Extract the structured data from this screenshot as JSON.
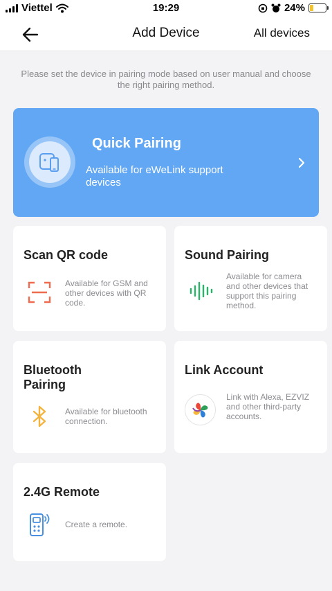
{
  "status_bar": {
    "carrier": "Viettel",
    "time": "19:29",
    "battery_percent": "24%",
    "battery_level": 0.24
  },
  "nav": {
    "title": "Add Device",
    "right_label": "All devices",
    "back_icon": "arrow-left-icon"
  },
  "hint": "Please set the device in pairing mode based on user manual and choose the right pairing method.",
  "quick_pairing": {
    "title": "Quick Pairing",
    "description": "Available for eWeLink support devices",
    "icon": "device-phone-icon",
    "color": "#62a7f3"
  },
  "cards": [
    {
      "title": "Scan QR code",
      "description": "Available for GSM and other devices with QR code.",
      "icon": "qr-scan-icon",
      "accent": "#ef6b4f"
    },
    {
      "title": "Sound Pairing",
      "description": "Available for camera and other devices that support this pairing method.",
      "icon": "sound-wave-icon",
      "accent": "#27b36a"
    },
    {
      "title": "Bluetooth Pairing",
      "description": "Available for bluetooth connection.",
      "icon": "bluetooth-icon",
      "accent": "#f2b440"
    },
    {
      "title": "Link Account",
      "description": "Link with Alexa, EZVIZ and other third-party accounts.",
      "icon": "ezviz-logo-icon",
      "accent": "#e8473a"
    },
    {
      "title": "2.4G Remote",
      "description": "Create a remote.",
      "icon": "remote-control-icon",
      "accent": "#4a90e2"
    }
  ]
}
